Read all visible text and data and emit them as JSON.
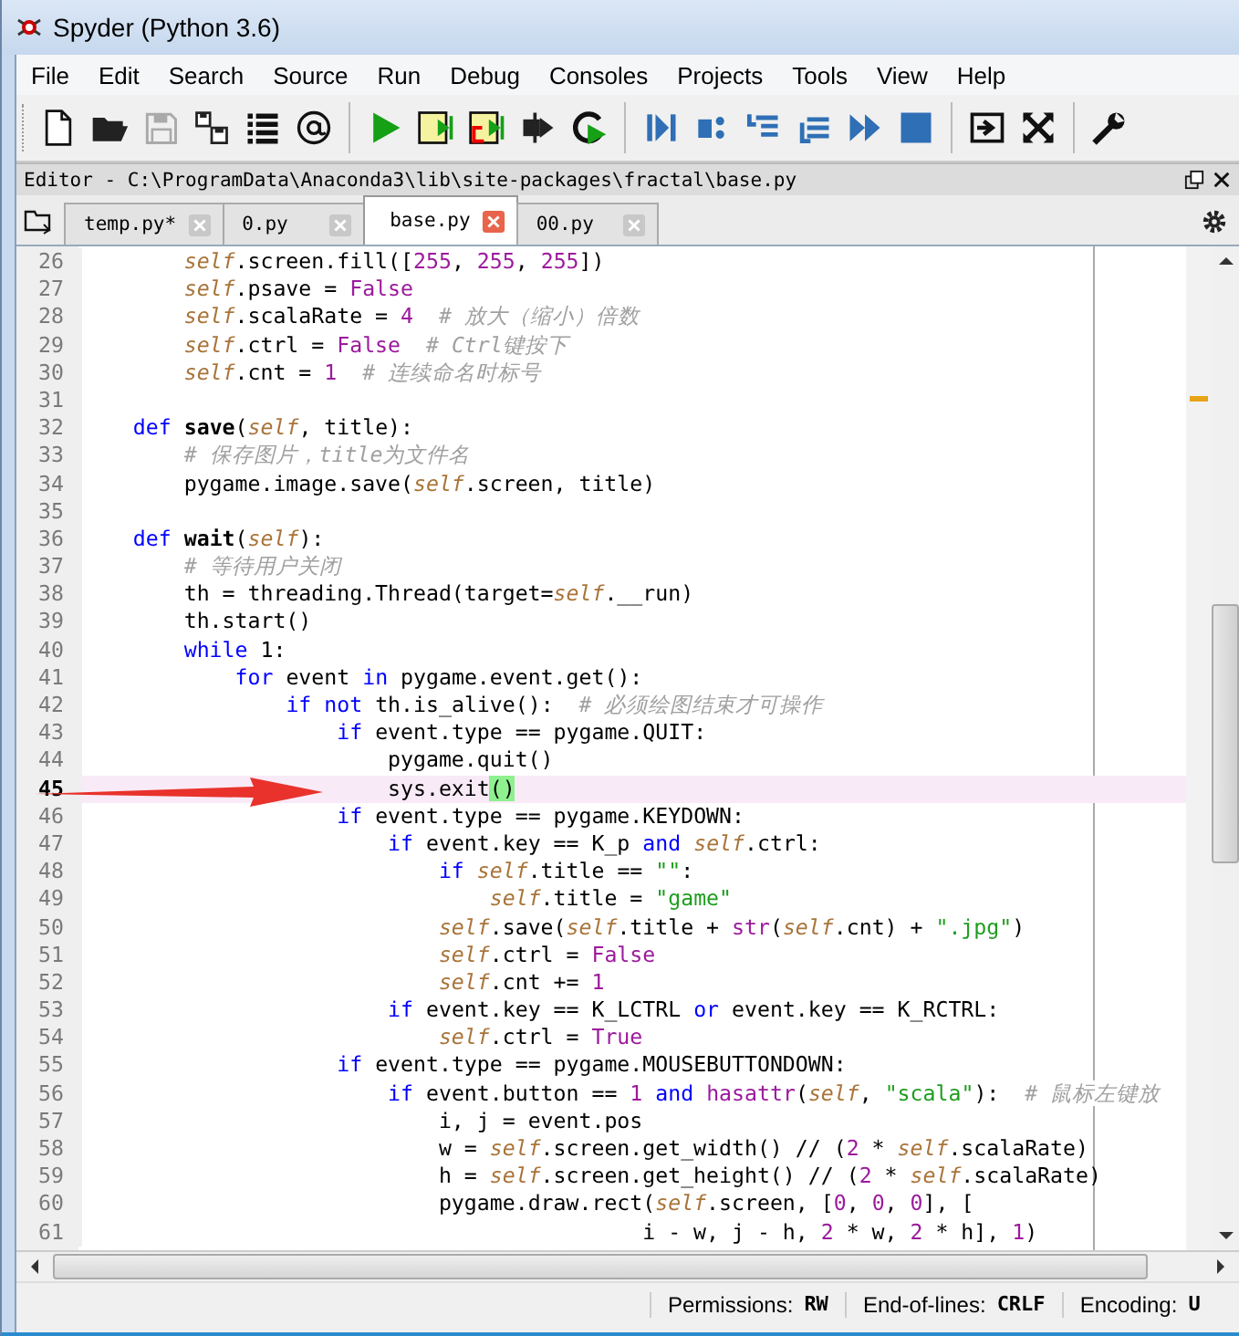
{
  "window": {
    "title": "Spyder (Python 3.6)"
  },
  "menu": [
    "File",
    "Edit",
    "Search",
    "Source",
    "Run",
    "Debug",
    "Consoles",
    "Projects",
    "Tools",
    "View",
    "Help"
  ],
  "editor": {
    "title": "Editor - C:\\ProgramData\\Anaconda3\\lib\\site-packages\\fractal\\base.py"
  },
  "tabs": [
    {
      "label": "temp.py*",
      "selected": false
    },
    {
      "label": "0.py",
      "selected": false
    },
    {
      "label": "base.py",
      "selected": true
    },
    {
      "label": "00.py",
      "selected": false
    }
  ],
  "code": {
    "lines": [
      {
        "number": "26",
        "current": false,
        "tokens": [
          {
            "kind": "self",
            "text": "        self"
          },
          {
            "kind": "plain",
            "text": ".screen.fill(["
          },
          {
            "kind": "num",
            "text": "255"
          },
          {
            "kind": "plain",
            "text": ", "
          },
          {
            "kind": "num",
            "text": "255"
          },
          {
            "kind": "plain",
            "text": ", "
          },
          {
            "kind": "num",
            "text": "255"
          },
          {
            "kind": "plain",
            "text": "])"
          }
        ]
      },
      {
        "number": "27",
        "current": false,
        "tokens": [
          {
            "kind": "self",
            "text": "        self"
          },
          {
            "kind": "plain",
            "text": ".psave = "
          },
          {
            "kind": "num",
            "text": "False"
          }
        ]
      },
      {
        "number": "28",
        "current": false,
        "tokens": [
          {
            "kind": "self",
            "text": "        self"
          },
          {
            "kind": "plain",
            "text": ".scalaRate = "
          },
          {
            "kind": "num",
            "text": "4"
          },
          {
            "kind": "comment",
            "text": "  # 放大（缩小）倍数"
          }
        ]
      },
      {
        "number": "29",
        "current": false,
        "tokens": [
          {
            "kind": "self",
            "text": "        self"
          },
          {
            "kind": "plain",
            "text": ".ctrl = "
          },
          {
            "kind": "num",
            "text": "False"
          },
          {
            "kind": "comment",
            "text": "  # Ctrl键按下"
          }
        ]
      },
      {
        "number": "30",
        "current": false,
        "tokens": [
          {
            "kind": "self",
            "text": "        self"
          },
          {
            "kind": "plain",
            "text": ".cnt = "
          },
          {
            "kind": "num",
            "text": "1"
          },
          {
            "kind": "comment",
            "text": "  # 连续命名时标号"
          }
        ]
      },
      {
        "number": "31",
        "current": false
      },
      {
        "number": "32",
        "current": false,
        "tokens": [
          {
            "kind": "keyword",
            "text": "    def"
          },
          {
            "kind": "defname",
            "text": " save"
          },
          {
            "kind": "plain",
            "text": "("
          },
          {
            "kind": "self",
            "text": "self"
          },
          {
            "kind": "plain",
            "text": ", title):"
          }
        ]
      },
      {
        "number": "33",
        "current": false,
        "tokens": [
          {
            "kind": "comment",
            "text": "        # 保存图片，title为文件名"
          }
        ]
      },
      {
        "number": "34",
        "current": false,
        "tokens": [
          {
            "kind": "plain",
            "text": "        pygame.image.save("
          },
          {
            "kind": "self",
            "text": "self"
          },
          {
            "kind": "plain",
            "text": ".screen, title)"
          }
        ]
      },
      {
        "number": "35",
        "current": false
      },
      {
        "number": "36",
        "current": false,
        "tokens": [
          {
            "kind": "keyword",
            "text": "    def"
          },
          {
            "kind": "defname",
            "text": " wait"
          },
          {
            "kind": "plain",
            "text": "("
          },
          {
            "kind": "self",
            "text": "self"
          },
          {
            "kind": "plain",
            "text": "):"
          }
        ]
      },
      {
        "number": "37",
        "current": false,
        "tokens": [
          {
            "kind": "comment",
            "text": "        # 等待用户关闭"
          }
        ]
      },
      {
        "number": "38",
        "current": false,
        "tokens": [
          {
            "kind": "plain",
            "text": "        th = threading.Thread(target="
          },
          {
            "kind": "self",
            "text": "self"
          },
          {
            "kind": "plain",
            "text": ".__run)"
          }
        ]
      },
      {
        "number": "39",
        "current": false,
        "tokens": [
          {
            "kind": "plain",
            "text": "        th.start()"
          }
        ]
      },
      {
        "number": "40",
        "current": false,
        "tokens": [
          {
            "kind": "keyword",
            "text": "        while"
          },
          {
            "kind": "plain",
            "text": " 1:"
          }
        ]
      },
      {
        "number": "41",
        "current": false,
        "tokens": [
          {
            "kind": "keyword",
            "text": "            for"
          },
          {
            "kind": "plain",
            "text": " event "
          },
          {
            "kind": "keyword",
            "text": "in"
          },
          {
            "kind": "plain",
            "text": " pygame.event.get():"
          }
        ]
      },
      {
        "number": "42",
        "current": false,
        "tokens": [
          {
            "kind": "keyword",
            "text": "                if"
          },
          {
            "kind": "keyword",
            "text": " not"
          },
          {
            "kind": "plain",
            "text": " th.is_alive():"
          },
          {
            "kind": "comment",
            "text": "  # 必须绘图结束才可操作"
          }
        ]
      },
      {
        "number": "43",
        "current": false,
        "tokens": [
          {
            "kind": "keyword",
            "text": "                    if"
          },
          {
            "kind": "plain",
            "text": " event.type == pygame.QUIT:"
          }
        ]
      },
      {
        "number": "44",
        "current": false,
        "tokens": [
          {
            "kind": "plain",
            "text": "                        pygame.quit()"
          }
        ]
      },
      {
        "number": "45",
        "current": true,
        "tokens": [
          {
            "kind": "plain",
            "text": "                        sys.exit"
          },
          {
            "kind": "match",
            "text": "()"
          }
        ]
      },
      {
        "number": "46",
        "current": false,
        "tokens": [
          {
            "kind": "keyword",
            "text": "                    if"
          },
          {
            "kind": "plain",
            "text": " event.type == pygame.KEYDOWN:"
          }
        ]
      },
      {
        "number": "47",
        "current": false,
        "tokens": [
          {
            "kind": "keyword",
            "text": "                        if"
          },
          {
            "kind": "plain",
            "text": " event.key == K_p "
          },
          {
            "kind": "keyword",
            "text": "and"
          },
          {
            "kind": "self",
            "text": " self"
          },
          {
            "kind": "plain",
            "text": ".ctrl:"
          }
        ]
      },
      {
        "number": "48",
        "current": false,
        "tokens": [
          {
            "kind": "keyword",
            "text": "                            if"
          },
          {
            "kind": "self",
            "text": " self"
          },
          {
            "kind": "plain",
            "text": ".title == "
          },
          {
            "kind": "string",
            "text": "\"\""
          },
          {
            "kind": "plain",
            "text": ":"
          }
        ]
      },
      {
        "number": "49",
        "current": false,
        "tokens": [
          {
            "kind": "self",
            "text": "                                self"
          },
          {
            "kind": "plain",
            "text": ".title = "
          },
          {
            "kind": "string",
            "text": "\"game\""
          }
        ]
      },
      {
        "number": "50",
        "current": false,
        "tokens": [
          {
            "kind": "self",
            "text": "                            self"
          },
          {
            "kind": "plain",
            "text": ".save("
          },
          {
            "kind": "self",
            "text": "self"
          },
          {
            "kind": "plain",
            "text": ".title + "
          },
          {
            "kind": "builtin",
            "text": "str"
          },
          {
            "kind": "plain",
            "text": "("
          },
          {
            "kind": "self",
            "text": "self"
          },
          {
            "kind": "plain",
            "text": ".cnt) + "
          },
          {
            "kind": "string",
            "text": "\".jpg\""
          },
          {
            "kind": "plain",
            "text": ")"
          }
        ]
      },
      {
        "number": "51",
        "current": false,
        "tokens": [
          {
            "kind": "self",
            "text": "                            self"
          },
          {
            "kind": "plain",
            "text": ".ctrl = "
          },
          {
            "kind": "num",
            "text": "False"
          }
        ]
      },
      {
        "number": "52",
        "current": false,
        "tokens": [
          {
            "kind": "self",
            "text": "                            self"
          },
          {
            "kind": "plain",
            "text": ".cnt += "
          },
          {
            "kind": "num",
            "text": "1"
          }
        ]
      },
      {
        "number": "53",
        "current": false,
        "tokens": [
          {
            "kind": "keyword",
            "text": "                        if"
          },
          {
            "kind": "plain",
            "text": " event.key == K_LCTRL "
          },
          {
            "kind": "keyword",
            "text": "or"
          },
          {
            "kind": "plain",
            "text": " event.key == K_RCTRL:"
          }
        ]
      },
      {
        "number": "54",
        "current": false,
        "tokens": [
          {
            "kind": "self",
            "text": "                            self"
          },
          {
            "kind": "plain",
            "text": ".ctrl = "
          },
          {
            "kind": "num",
            "text": "True"
          }
        ]
      },
      {
        "number": "55",
        "current": false,
        "tokens": [
          {
            "kind": "keyword",
            "text": "                    if"
          },
          {
            "kind": "plain",
            "text": " event.type == pygame.MOUSEBUTTONDOWN:"
          }
        ]
      },
      {
        "number": "56",
        "current": false,
        "tokens": [
          {
            "kind": "keyword",
            "text": "                        if"
          },
          {
            "kind": "plain",
            "text": " event.button == "
          },
          {
            "kind": "num",
            "text": "1"
          },
          {
            "kind": "keyword",
            "text": " and"
          },
          {
            "kind": "builtin",
            "text": " hasattr"
          },
          {
            "kind": "plain",
            "text": "("
          },
          {
            "kind": "self",
            "text": "self"
          },
          {
            "kind": "plain",
            "text": ", "
          },
          {
            "kind": "string",
            "text": "\"scala\""
          },
          {
            "kind": "plain",
            "text": "):"
          },
          {
            "kind": "comment",
            "text": "  # 鼠标左键放"
          }
        ]
      },
      {
        "number": "57",
        "current": false,
        "tokens": [
          {
            "kind": "plain",
            "text": "                            i, j = event.pos"
          }
        ]
      },
      {
        "number": "58",
        "current": false,
        "tokens": [
          {
            "kind": "plain",
            "text": "                            w = "
          },
          {
            "kind": "self",
            "text": "self"
          },
          {
            "kind": "plain",
            "text": ".screen.get_width() // ("
          },
          {
            "kind": "num",
            "text": "2"
          },
          {
            "kind": "plain",
            "text": " * "
          },
          {
            "kind": "self",
            "text": "self"
          },
          {
            "kind": "plain",
            "text": ".scalaRate)"
          }
        ]
      },
      {
        "number": "59",
        "current": false,
        "tokens": [
          {
            "kind": "plain",
            "text": "                            h = "
          },
          {
            "kind": "self",
            "text": "self"
          },
          {
            "kind": "plain",
            "text": ".screen.get_height() // ("
          },
          {
            "kind": "num",
            "text": "2"
          },
          {
            "kind": "plain",
            "text": " * "
          },
          {
            "kind": "self",
            "text": "self"
          },
          {
            "kind": "plain",
            "text": ".scalaRate)"
          }
        ]
      },
      {
        "number": "60",
        "current": false,
        "tokens": [
          {
            "kind": "plain",
            "text": "                            pygame.draw.rect("
          },
          {
            "kind": "self",
            "text": "self"
          },
          {
            "kind": "plain",
            "text": ".screen, ["
          },
          {
            "kind": "num",
            "text": "0"
          },
          {
            "kind": "plain",
            "text": ", "
          },
          {
            "kind": "num",
            "text": "0"
          },
          {
            "kind": "plain",
            "text": ", "
          },
          {
            "kind": "num",
            "text": "0"
          },
          {
            "kind": "plain",
            "text": "], ["
          }
        ]
      },
      {
        "number": "61",
        "current": false,
        "tokens": [
          {
            "kind": "plain",
            "text": "                                            i - w, j - h, "
          },
          {
            "kind": "num",
            "text": "2"
          },
          {
            "kind": "plain",
            "text": " * w, "
          },
          {
            "kind": "num",
            "text": "2"
          },
          {
            "kind": "plain",
            "text": " * h], "
          },
          {
            "kind": "num",
            "text": "1"
          },
          {
            "kind": "plain",
            "text": ")"
          }
        ]
      }
    ]
  },
  "status_bar": [
    {
      "label": "Permissions:",
      "value": "RW"
    },
    {
      "label": "End-of-lines:",
      "value": "CRLF"
    },
    {
      "label": "Encoding:",
      "value": "U"
    }
  ]
}
